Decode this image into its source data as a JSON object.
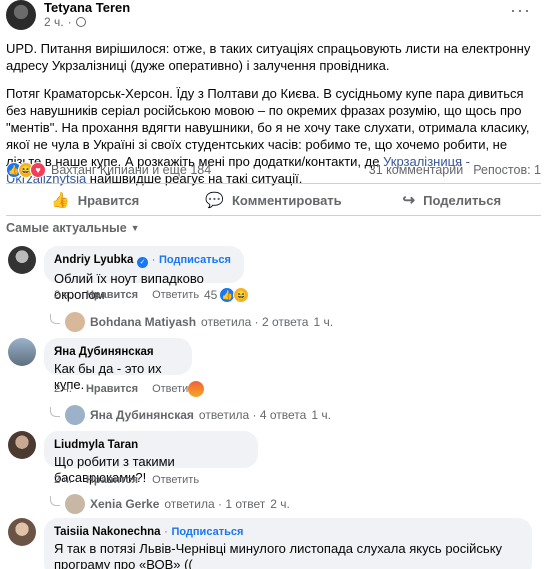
{
  "post": {
    "author": "Tetyana Teren",
    "time": "2 ч.",
    "more": "···",
    "p1": "UPD. Питання вирішилося: отже, в таких ситуаціях спрацьовують листи на електронну адресу Укрзалізниці (дуже оперативно) і залучення провідника.",
    "p2_before": "Потяг Краматорськ-Херсон. Їду з Полтави до Києва. В сусідньому купе пара дивиться без навушників серіал російською мовою – по окремих фразах розумію, що щось про \"ментів\". На прохання вдягти навушники, бо я не хочу таке слухати, отримала класику, якої не чула в Україні зі своїх студентських часів: робимо те, що хочемо робити, не лізьте в наше купе. А розкажіть мені про додатки/контакти, де ",
    "p2_link": "Укрзалізниця - Ukrzaliznytsia",
    "p2_after": " найшвидше реагує на такі ситуації."
  },
  "reactions": {
    "names": "Вахтанг Кипиани и ещё 184",
    "comments": "31 комментарий",
    "shares": "Репостов: 1"
  },
  "actions": {
    "like": "Нравится",
    "comment": "Комментировать",
    "share": "Поделиться"
  },
  "sort_label": "Самые актуальные",
  "comments": [
    {
      "name": "Andriy Lyubka",
      "follow": "Подписаться",
      "text": "Облий їх ноут випадково окропом",
      "time": "2 ч.",
      "like": "Нравится",
      "reply": "Ответить",
      "reactions_count": "45",
      "reply_author": "Bohdana Matiyash",
      "reply_text": "ответила · 2 ответа",
      "reply_time": "1 ч."
    },
    {
      "name": "Яна Дубинянская",
      "text": "Как бы да - это их купе.",
      "time": "2 ч.",
      "like": "Нравится",
      "reply": "Ответить",
      "reply_author": "Яна Дубинянская",
      "reply_text": "ответила · 4 ответа",
      "reply_time": "1 ч."
    },
    {
      "name": "Liudmyla Taran",
      "text": "Що робити з такими басаврюками?!",
      "time": "2 ч.",
      "like": "Нравится",
      "reply": "Ответить",
      "reply_author": "Xenia Gerke",
      "reply_text": "ответила · 1 ответ",
      "reply_time": "2 ч."
    },
    {
      "name": "Taisiia Nakonechna",
      "follow": "Подписаться",
      "text": "Я так в потязі Львів-Чернівці минулого листопада слухала якусь російську програму про «ВОВ» (("
    }
  ],
  "colors": {
    "accent": "#1877f2",
    "muted": "#65676b",
    "bubble": "#f0f2f5"
  }
}
